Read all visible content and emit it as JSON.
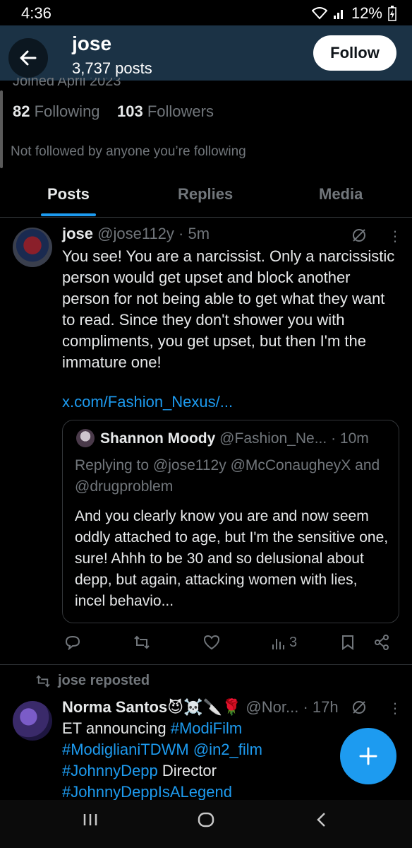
{
  "status_bar": {
    "time": "4:36",
    "battery": "12%"
  },
  "header": {
    "name": "jose",
    "posts_count": "3,737 posts",
    "follow_label": "Follow"
  },
  "profile": {
    "joined": "Joined April 2023",
    "following_count": "82",
    "following_label": "Following",
    "followers_count": "103",
    "followers_label": "Followers",
    "not_followed_text": "Not followed by anyone you’re following"
  },
  "tabs": [
    {
      "label": "Posts",
      "active": true
    },
    {
      "label": "Replies",
      "active": false
    },
    {
      "label": "Media",
      "active": false
    }
  ],
  "post1": {
    "name": "jose",
    "handle": "@jose112y",
    "time": "· 5m",
    "text": "You see! You are a narcissist. Only a narcissistic person would get upset and block another person for not being able to get what they want to read. Since they don't shower you with compliments, you get upset, but then I'm the immature one!",
    "link": "x.com/Fashion_Nexus/...",
    "quote": {
      "name": "Shannon Moody",
      "handle": "@Fashion_Ne...",
      "time": "· 10m",
      "replying_prefix": "Replying to",
      "reply_to_1": "@jose112y",
      "reply_to_2": "@McConaugheyX",
      "reply_and": "and",
      "reply_to_3": "@drugproblem",
      "text": "And you clearly know you are and now seem oddly attached to age, but I'm the sensitive one, sure! Ahhh to be 30 and so delusional about depp, but again, attacking women with lies, incel behavio..."
    },
    "views": "3"
  },
  "repost_label": "jose reposted",
  "post2": {
    "name": "Norma Santos",
    "emojis": "😈☠️🔪🌹",
    "handle": "@Nor...",
    "time": "· 17h",
    "text_intro": "ET announcing",
    "tag1": "#ModiFilm",
    "tag2": "#ModiglianiTDWM",
    "tag3": "@in2_film",
    "tag4": "#JohnnyDepp",
    "word_director": "Director",
    "tag5": "#JohnnyDeppIsALegend"
  },
  "colors": {
    "accent": "#1d9bf0",
    "header_bg": "#1b3245",
    "background": "#000000",
    "muted": "#71767b"
  }
}
